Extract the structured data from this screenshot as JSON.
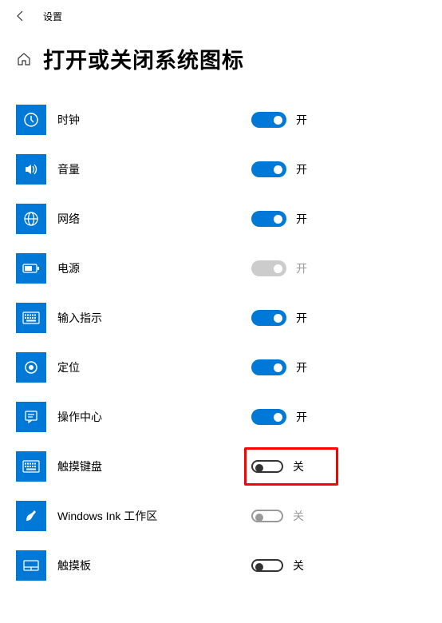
{
  "app_title": "设置",
  "page_title": "打开或关闭系统图标",
  "state_labels": {
    "on": "开",
    "off": "关"
  },
  "options": [
    {
      "id": "clock",
      "label": "时钟",
      "state": "on",
      "interactable": true
    },
    {
      "id": "volume",
      "label": "音量",
      "state": "on",
      "interactable": true
    },
    {
      "id": "network",
      "label": "网络",
      "state": "on",
      "interactable": true
    },
    {
      "id": "power",
      "label": "电源",
      "state": "disabled-on",
      "interactable": false
    },
    {
      "id": "input-indicator",
      "label": "输入指示",
      "state": "on",
      "interactable": true
    },
    {
      "id": "location",
      "label": "定位",
      "state": "on",
      "interactable": true
    },
    {
      "id": "action-center",
      "label": "操作中心",
      "state": "on",
      "interactable": true
    },
    {
      "id": "touch-keyboard",
      "label": "触摸键盘",
      "state": "off",
      "interactable": true,
      "highlighted": true
    },
    {
      "id": "windows-ink",
      "label": "Windows Ink 工作区",
      "state": "disabled-off",
      "interactable": false
    },
    {
      "id": "touchpad",
      "label": "触摸板",
      "state": "off",
      "interactable": true
    }
  ]
}
